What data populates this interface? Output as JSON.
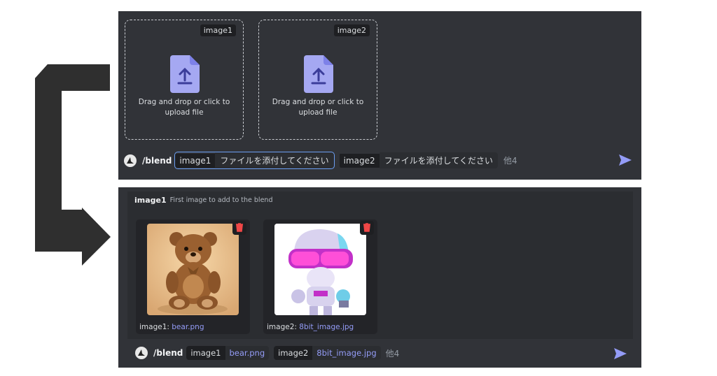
{
  "colors": {
    "panel": "#313338",
    "accent": "#5865f2",
    "link": "#949cf7",
    "arrow": "#2f2f2f"
  },
  "top": {
    "dropzones": [
      {
        "tag": "image1",
        "text": "Drag and drop or click to upload file",
        "icon": "upload-file-icon"
      },
      {
        "tag": "image2",
        "text": "Drag and drop or click to upload file",
        "icon": "upload-file-icon"
      }
    ],
    "command": "/blend",
    "options": [
      {
        "key": "image1",
        "value": "ファイルを添付してください"
      },
      {
        "key": "image2",
        "value": "ファイルを添付してください"
      }
    ],
    "more": "他4",
    "send_icon": "send-icon"
  },
  "bottom": {
    "header_key": "image1",
    "header_desc": "First image to add to the blend",
    "cards": [
      {
        "label": "image1: ",
        "file": "bear.png",
        "icon": "trash-icon"
      },
      {
        "label": "image2: ",
        "file": "8bit_image.jpg",
        "icon": "trash-icon"
      }
    ],
    "command": "/blend",
    "options": [
      {
        "key": "image1",
        "value": "bear.png"
      },
      {
        "key": "image2",
        "value": "8bit_image.jpg"
      }
    ],
    "more": "他4",
    "send_icon": "send-icon"
  }
}
